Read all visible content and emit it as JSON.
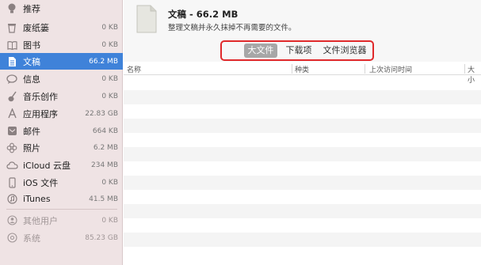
{
  "sidebar": {
    "items": [
      {
        "label": "推荐",
        "size": "",
        "icon": "lightbulb-icon"
      },
      {
        "label": "废纸篓",
        "size": "0 KB",
        "icon": "trash-icon"
      },
      {
        "label": "图书",
        "size": "0 KB",
        "icon": "book-icon"
      },
      {
        "label": "文稿",
        "size": "66.2 MB",
        "icon": "document-icon",
        "selected": true
      },
      {
        "label": "信息",
        "size": "0 KB",
        "icon": "chat-bubble-icon"
      },
      {
        "label": "音乐创作",
        "size": "0 KB",
        "icon": "guitar-icon"
      },
      {
        "label": "应用程序",
        "size": "22.83 GB",
        "icon": "apps-icon"
      },
      {
        "label": "邮件",
        "size": "664 KB",
        "icon": "mail-icon"
      },
      {
        "label": "照片",
        "size": "6.2 MB",
        "icon": "flower-icon"
      },
      {
        "label": "iCloud 云盘",
        "size": "234 MB",
        "icon": "cloud-icon"
      },
      {
        "label": "iOS 文件",
        "size": "0 KB",
        "icon": "phone-icon"
      },
      {
        "label": "iTunes",
        "size": "41.5 MB",
        "icon": "music-note-icon"
      },
      {
        "label": "其他用户",
        "size": "0 KB",
        "icon": "users-icon",
        "muted": true
      },
      {
        "label": "系统",
        "size": "85.23 GB",
        "icon": "gear-icon",
        "muted": true
      }
    ]
  },
  "header": {
    "title": "文稿 - 66.2 MB",
    "subtitle": "整理文稿并永久抹掉不再需要的文件。"
  },
  "tabs": [
    {
      "label": "大文件",
      "active": true
    },
    {
      "label": "下载项",
      "active": false
    },
    {
      "label": "文件浏览器",
      "active": false
    }
  ],
  "table": {
    "columns": [
      "名称",
      "种类",
      "上次访问时间",
      "大小"
    ]
  },
  "colors": {
    "sidebar_bg": "#efe3e4",
    "selected": "#3f82d9",
    "highlight_box": "#e0292b"
  }
}
